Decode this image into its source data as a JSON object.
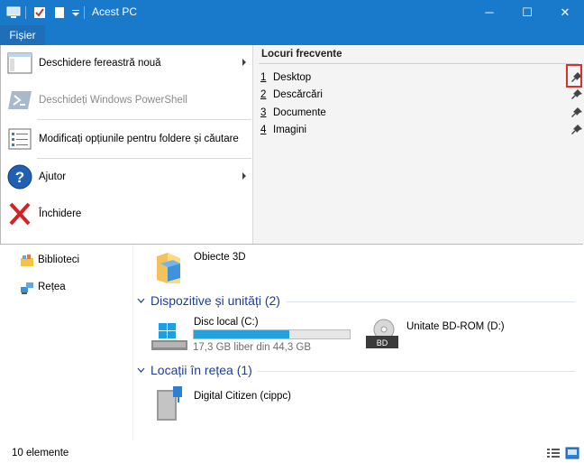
{
  "window": {
    "title": "Acest PC",
    "controls": {
      "minimize": "─",
      "maximize": "☐",
      "close": "✕"
    }
  },
  "ribbon": {
    "file_tab": "Fișier"
  },
  "file_menu": {
    "items": [
      {
        "label": "Deschidere fereastră nouă",
        "icon": "new-window-icon",
        "submenu": true,
        "enabled": true
      },
      {
        "label": "Deschideți Windows PowerShell",
        "icon": "powershell-icon",
        "submenu": false,
        "enabled": false
      },
      {
        "label": "Modificați opțiunile pentru foldere și căutare",
        "icon": "folder-options-icon",
        "submenu": false,
        "enabled": true
      },
      {
        "label": "Ajutor",
        "icon": "help-icon",
        "submenu": true,
        "enabled": true
      },
      {
        "label": "Închidere",
        "icon": "close-x-icon",
        "submenu": false,
        "enabled": true
      }
    ],
    "frequent": {
      "heading": "Locuri frecvente",
      "items": [
        {
          "num": "1",
          "name": "Desktop"
        },
        {
          "num": "2",
          "name": "Descărcări"
        },
        {
          "num": "3",
          "name": "Documente"
        },
        {
          "num": "4",
          "name": "Imagini"
        }
      ]
    }
  },
  "nav": {
    "items": [
      {
        "label": "Biblioteci",
        "icon": "libraries-icon"
      },
      {
        "label": "Rețea",
        "icon": "network-icon"
      }
    ]
  },
  "content": {
    "folder_3d": {
      "name": "Obiecte 3D",
      "icon": "folder-3d-icon"
    },
    "devices_group": {
      "title": "Dispozitive și unități (2)"
    },
    "local_disk": {
      "name": "Disc local (C:)",
      "free": "17,3 GB liber din 44,3 GB",
      "used_fraction": 0.61,
      "icon": "windows-drive-icon"
    },
    "bd_rom": {
      "name": "Unitate BD-ROM (D:)",
      "icon": "bd-drive-icon",
      "badge": "BD"
    },
    "network_group": {
      "title": "Locații în rețea (1)"
    },
    "network_location": {
      "name": "Digital Citizen (cippc)",
      "icon": "network-drive-icon"
    }
  },
  "status": {
    "count": "10 elemente"
  },
  "colors": {
    "titlebar": "#1979ca",
    "accent": "#1c3d94",
    "bar_fill": "#26a0da",
    "highlight": "#d9302c"
  }
}
